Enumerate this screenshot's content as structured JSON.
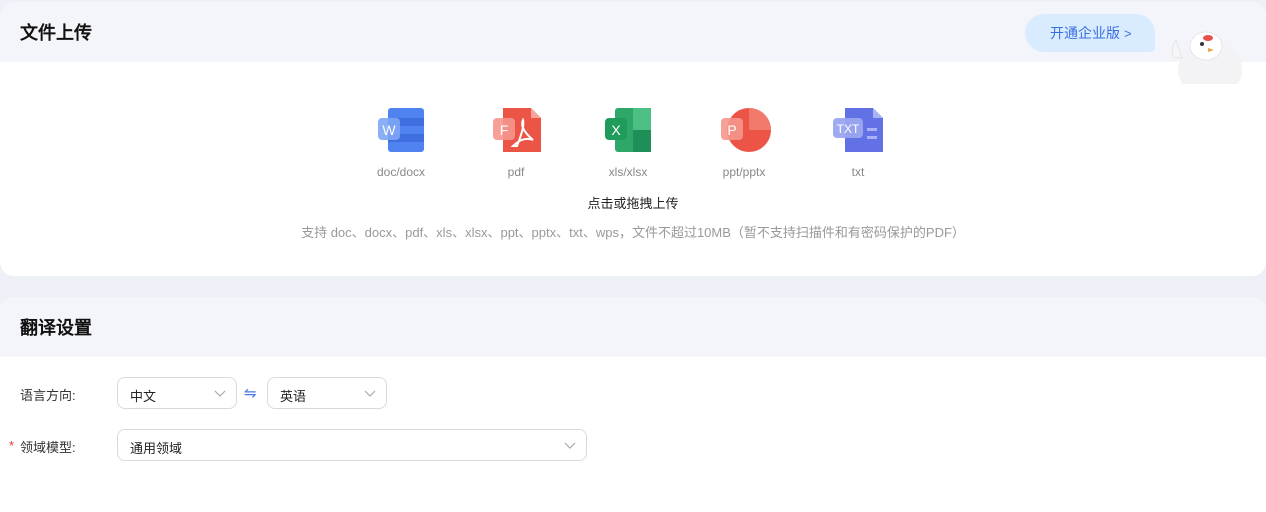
{
  "upload": {
    "title": "文件上传",
    "upgrade_label": "开通企业版",
    "file_types": [
      {
        "label": "doc/docx",
        "icon": "word-doc-icon",
        "color": "#3f6fe0"
      },
      {
        "label": "pdf",
        "icon": "pdf-icon",
        "color": "#e8473b"
      },
      {
        "label": "xls/xlsx",
        "icon": "excel-icon",
        "color": "#1e8f57"
      },
      {
        "label": "ppt/pptx",
        "icon": "powerpoint-icon",
        "color": "#e9493c"
      },
      {
        "label": "txt",
        "icon": "txt-icon",
        "color": "#5a6be0"
      }
    ],
    "prompt": "点击或拖拽上传",
    "hint": "支持 doc、docx、pdf、xls、xlsx、ppt、pptx、txt、wps，文件不超过10MB（暂不支持扫描件和有密码保护的PDF）"
  },
  "settings": {
    "title": "翻译设置",
    "language_label": "语言方向:",
    "source_language": "中文",
    "target_language": "英语",
    "domain_label": "领域模型:",
    "domain_value": "通用领域"
  },
  "colors": {
    "accent": "#3a6fe0",
    "upgrade_bg": "#d9ecff",
    "required": "#e53935"
  }
}
